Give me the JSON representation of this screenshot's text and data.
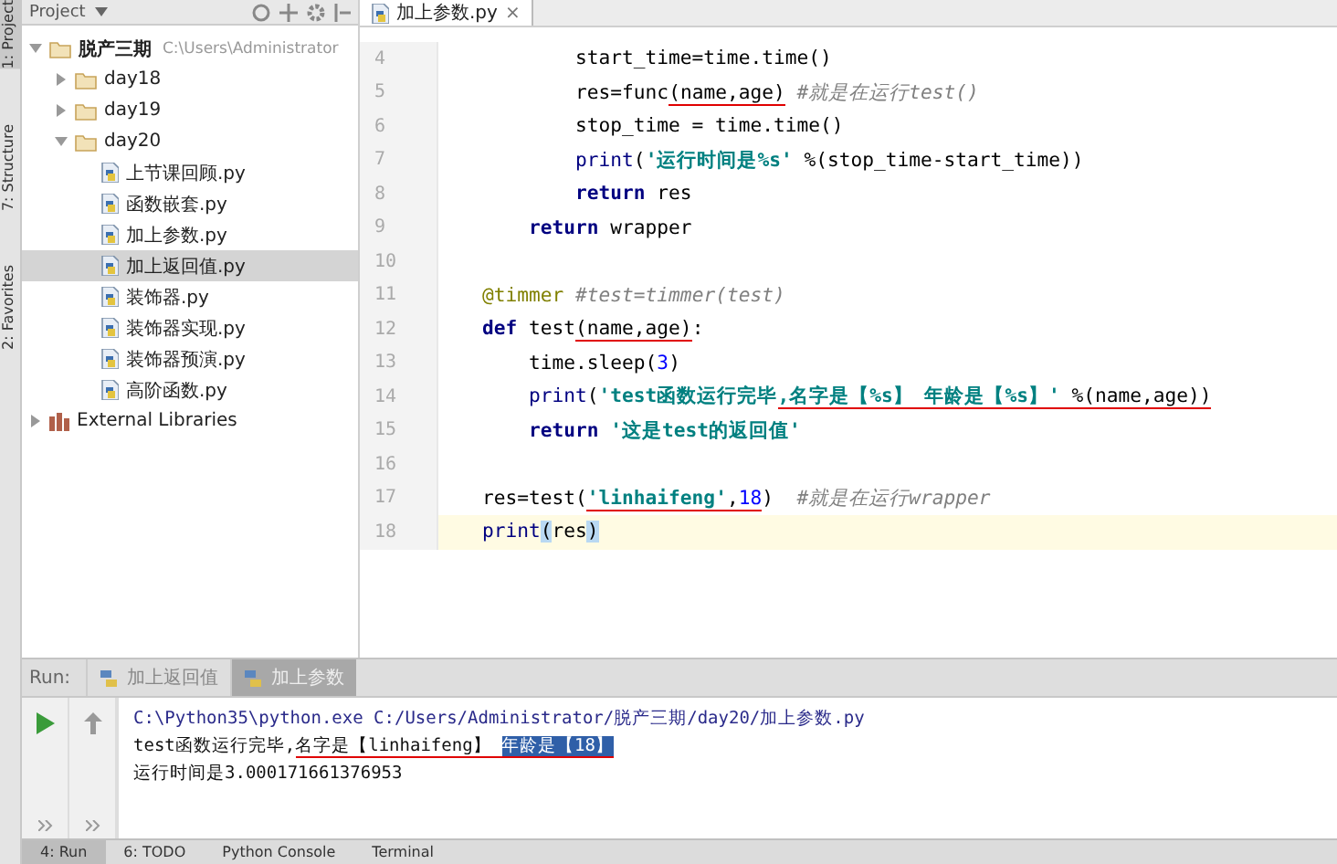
{
  "side_strip": [
    {
      "label": "1: Project",
      "selected": true
    },
    {
      "label": "7: Structure",
      "selected": false
    },
    {
      "label": "2: Favorites",
      "selected": false
    }
  ],
  "project_panel": {
    "title": "Project",
    "tree": [
      {
        "label": "脱产三期",
        "path": "C:\\Users\\Administrator",
        "kind": "folder",
        "expanded": true,
        "selected": false,
        "children": [
          {
            "label": "day18",
            "kind": "folder",
            "expanded": false,
            "selected": false
          },
          {
            "label": "day19",
            "kind": "folder",
            "expanded": false,
            "selected": false
          },
          {
            "label": "day20",
            "kind": "folder",
            "expanded": true,
            "selected": false,
            "children": [
              {
                "label": "上节课回顾.py",
                "kind": "file",
                "selected": false
              },
              {
                "label": "函数嵌套.py",
                "kind": "file",
                "selected": false
              },
              {
                "label": "加上参数.py",
                "kind": "file",
                "selected": false
              },
              {
                "label": "加上返回值.py",
                "kind": "file",
                "selected": true
              },
              {
                "label": "装饰器.py",
                "kind": "file",
                "selected": false
              },
              {
                "label": "装饰器实现.py",
                "kind": "file",
                "selected": false
              },
              {
                "label": "装饰器预演.py",
                "kind": "file",
                "selected": false
              },
              {
                "label": "高阶函数.py",
                "kind": "file",
                "selected": false
              }
            ]
          }
        ]
      },
      {
        "label": "External Libraries",
        "kind": "library",
        "expanded": false,
        "selected": false
      }
    ]
  },
  "editor": {
    "tabs": [
      {
        "label": "加上参数.py",
        "close": "×",
        "selected": true
      }
    ],
    "lines": [
      {
        "number": "4",
        "current": false,
        "segments": [
          {
            "text": "        start_time=time.time()",
            "kind": "plain",
            "marked": false
          }
        ]
      },
      {
        "number": "5",
        "current": false,
        "segments": [
          {
            "text": "        res=func",
            "kind": "plain",
            "marked": false
          },
          {
            "text": "(name,age)",
            "kind": "plain",
            "marked": true
          },
          {
            "text": " #就是在运行test()",
            "kind": "comment",
            "marked": false
          }
        ]
      },
      {
        "number": "6",
        "current": false,
        "segments": [
          {
            "text": "        stop_time = time.time()",
            "kind": "plain",
            "marked": false
          }
        ]
      },
      {
        "number": "7",
        "current": false,
        "segments": [
          {
            "text": "        print",
            "kind": "builtin",
            "marked": false
          },
          {
            "text": "(",
            "kind": "plain",
            "marked": false
          },
          {
            "text": "'运行时间是%s'",
            "kind": "string",
            "marked": false
          },
          {
            "text": " %(stop_time-start_time))",
            "kind": "plain",
            "marked": false
          }
        ]
      },
      {
        "number": "8",
        "current": false,
        "segments": [
          {
            "text": "        return",
            "kind": "keyword",
            "marked": false
          },
          {
            "text": " res",
            "kind": "plain",
            "marked": false
          }
        ]
      },
      {
        "number": "9",
        "current": false,
        "segments": [
          {
            "text": "    return",
            "kind": "keyword",
            "marked": false
          },
          {
            "text": " wrapper",
            "kind": "plain",
            "marked": false
          }
        ]
      },
      {
        "number": "10",
        "current": false
      },
      {
        "number": "11",
        "current": false,
        "segments": [
          {
            "text": "@timmer",
            "kind": "decorator",
            "marked": false
          },
          {
            "text": " #test=timmer(test)",
            "kind": "comment",
            "marked": false
          }
        ]
      },
      {
        "number": "12",
        "current": false,
        "segments": [
          {
            "text": "def",
            "kind": "keyword",
            "marked": false
          },
          {
            "text": " test",
            "kind": "plain",
            "marked": false
          },
          {
            "text": "(name,age)",
            "kind": "plain",
            "marked": true
          },
          {
            "text": ":",
            "kind": "plain",
            "marked": false
          }
        ]
      },
      {
        "number": "13",
        "current": false,
        "segments": [
          {
            "text": "    time.sleep(",
            "kind": "plain",
            "marked": false
          },
          {
            "text": "3",
            "kind": "number",
            "marked": false
          },
          {
            "text": ")",
            "kind": "plain",
            "marked": false
          }
        ]
      },
      {
        "number": "14",
        "current": false,
        "segments": [
          {
            "text": "    print",
            "kind": "builtin",
            "marked": false
          },
          {
            "text": "(",
            "kind": "plain",
            "marked": false
          },
          {
            "text": "'test函数运行完毕",
            "kind": "string",
            "marked": false
          },
          {
            "text": ",名字是【%s】 年龄是【%s】'",
            "kind": "string",
            "marked": true
          },
          {
            "text": " %(name,age))",
            "kind": "plain",
            "marked": true
          }
        ]
      },
      {
        "number": "15",
        "current": false,
        "segments": [
          {
            "text": "    return",
            "kind": "keyword",
            "marked": false
          },
          {
            "text": " '这是test的返回值'",
            "kind": "string",
            "marked": false
          }
        ]
      },
      {
        "number": "16",
        "current": false
      },
      {
        "number": "17",
        "current": false,
        "segments": [
          {
            "text": "res=test(",
            "kind": "plain",
            "marked": false
          },
          {
            "text": "'linhaifeng'",
            "kind": "string",
            "marked": true
          },
          {
            "text": ",",
            "kind": "plain",
            "marked": true
          },
          {
            "text": "18",
            "kind": "number",
            "marked": true
          },
          {
            "text": ")",
            "kind": "plain",
            "marked": false
          },
          {
            "text": "  #就是在运行wrapper",
            "kind": "comment",
            "marked": false
          }
        ]
      },
      {
        "number": "18",
        "current": true,
        "segments": [
          {
            "text": "print",
            "kind": "builtin",
            "marked": false
          },
          {
            "text": "(",
            "kind": "brace",
            "marked": false
          },
          {
            "text": "res",
            "kind": "plain",
            "marked": false
          },
          {
            "text": ")",
            "kind": "brace",
            "marked": false
          }
        ]
      }
    ]
  },
  "run_panel": {
    "label": "Run:",
    "tabs": [
      {
        "label": "加上返回值",
        "selected": false
      },
      {
        "label": "加上参数",
        "selected": true
      }
    ],
    "console": [
      {
        "kind": "command",
        "segments": [
          {
            "text": "C:\\Python35\\python.exe C:/Users/Administrator/脱产三期/day20/加上参数.py",
            "selected": false,
            "marked": false
          }
        ]
      },
      {
        "kind": "output",
        "segments": [
          {
            "text": "test函数运行完毕,",
            "selected": false,
            "marked": false
          },
          {
            "text": "名字是【linhaifeng】 ",
            "selected": false,
            "marked": true
          },
          {
            "text": "年龄是【18】",
            "selected": true,
            "marked": true
          }
        ]
      },
      {
        "kind": "output",
        "segments": [
          {
            "text": "运行时间是3.000171661376953",
            "selected": false,
            "marked": false
          }
        ]
      }
    ]
  },
  "bottom_bar": [
    {
      "label": "4: Run",
      "selected": true
    },
    {
      "label": "6: TODO",
      "selected": false
    },
    {
      "label": "Python Console",
      "selected": false
    },
    {
      "label": "Terminal",
      "selected": false
    }
  ]
}
